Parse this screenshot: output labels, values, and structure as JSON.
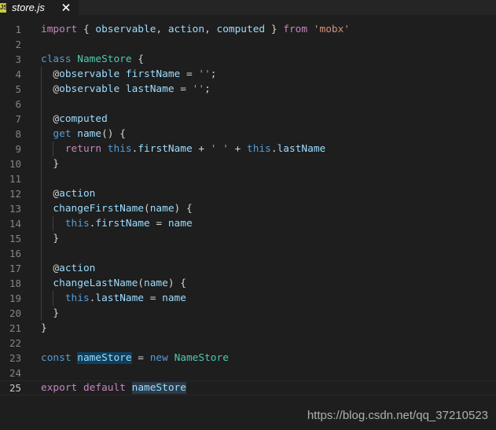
{
  "tab": {
    "icon_text": "JS",
    "filename": "store.js",
    "close_icon": "close-icon"
  },
  "editor": {
    "lines": [
      {
        "n": "1",
        "tokens": [
          [
            "ctl",
            "import"
          ],
          [
            "plain",
            " { "
          ],
          [
            "var",
            "observable"
          ],
          [
            "plain",
            ", "
          ],
          [
            "var",
            "action"
          ],
          [
            "plain",
            ", "
          ],
          [
            "var",
            "computed"
          ],
          [
            "plain",
            " } "
          ],
          [
            "ctl",
            "from"
          ],
          [
            "plain",
            " "
          ],
          [
            "str",
            "'mobx'"
          ]
        ]
      },
      {
        "n": "2",
        "tokens": []
      },
      {
        "n": "3",
        "tokens": [
          [
            "kw",
            "class"
          ],
          [
            "plain",
            " "
          ],
          [
            "cls",
            "NameStore"
          ],
          [
            "plain",
            " {"
          ]
        ]
      },
      {
        "n": "4",
        "tokens": [
          [
            "plain",
            "  "
          ],
          [
            "dec",
            "@"
          ],
          [
            "var",
            "observable"
          ],
          [
            "plain",
            " "
          ],
          [
            "var",
            "firstName"
          ],
          [
            "plain",
            " = "
          ],
          [
            "str",
            "''"
          ],
          [
            "plain",
            ";"
          ]
        ]
      },
      {
        "n": "5",
        "tokens": [
          [
            "plain",
            "  "
          ],
          [
            "dec",
            "@"
          ],
          [
            "var",
            "observable"
          ],
          [
            "plain",
            " "
          ],
          [
            "var",
            "lastName"
          ],
          [
            "plain",
            " = "
          ],
          [
            "str",
            "''"
          ],
          [
            "plain",
            ";"
          ]
        ]
      },
      {
        "n": "6",
        "tokens": []
      },
      {
        "n": "7",
        "tokens": [
          [
            "plain",
            "  "
          ],
          [
            "dec",
            "@"
          ],
          [
            "var",
            "computed"
          ]
        ]
      },
      {
        "n": "8",
        "tokens": [
          [
            "plain",
            "  "
          ],
          [
            "kw",
            "get"
          ],
          [
            "plain",
            " "
          ],
          [
            "var",
            "name"
          ],
          [
            "plain",
            "() {"
          ]
        ]
      },
      {
        "n": "9",
        "tokens": [
          [
            "plain",
            "    "
          ],
          [
            "ctl",
            "return"
          ],
          [
            "plain",
            " "
          ],
          [
            "kw",
            "this"
          ],
          [
            "plain",
            "."
          ],
          [
            "var",
            "firstName"
          ],
          [
            "plain",
            " + "
          ],
          [
            "str",
            "' '"
          ],
          [
            "plain",
            " + "
          ],
          [
            "kw",
            "this"
          ],
          [
            "plain",
            "."
          ],
          [
            "var",
            "lastName"
          ]
        ]
      },
      {
        "n": "10",
        "tokens": [
          [
            "plain",
            "  }"
          ]
        ]
      },
      {
        "n": "11",
        "tokens": []
      },
      {
        "n": "12",
        "tokens": [
          [
            "plain",
            "  "
          ],
          [
            "dec",
            "@"
          ],
          [
            "var",
            "action"
          ]
        ]
      },
      {
        "n": "13",
        "tokens": [
          [
            "plain",
            "  "
          ],
          [
            "var",
            "changeFirstName"
          ],
          [
            "plain",
            "("
          ],
          [
            "var",
            "name"
          ],
          [
            "plain",
            ") {"
          ]
        ]
      },
      {
        "n": "14",
        "tokens": [
          [
            "plain",
            "    "
          ],
          [
            "kw",
            "this"
          ],
          [
            "plain",
            "."
          ],
          [
            "var",
            "firstName"
          ],
          [
            "plain",
            " = "
          ],
          [
            "var",
            "name"
          ]
        ]
      },
      {
        "n": "15",
        "tokens": [
          [
            "plain",
            "  }"
          ]
        ]
      },
      {
        "n": "16",
        "tokens": []
      },
      {
        "n": "17",
        "tokens": [
          [
            "plain",
            "  "
          ],
          [
            "dec",
            "@"
          ],
          [
            "var",
            "action"
          ]
        ]
      },
      {
        "n": "18",
        "tokens": [
          [
            "plain",
            "  "
          ],
          [
            "var",
            "changeLastName"
          ],
          [
            "plain",
            "("
          ],
          [
            "var",
            "name"
          ],
          [
            "plain",
            ") {"
          ]
        ]
      },
      {
        "n": "19",
        "tokens": [
          [
            "plain",
            "    "
          ],
          [
            "kw",
            "this"
          ],
          [
            "plain",
            "."
          ],
          [
            "var",
            "lastName"
          ],
          [
            "plain",
            " = "
          ],
          [
            "var",
            "name"
          ]
        ]
      },
      {
        "n": "20",
        "tokens": [
          [
            "plain",
            "  }"
          ]
        ]
      },
      {
        "n": "21",
        "tokens": [
          [
            "plain",
            "}"
          ]
        ]
      },
      {
        "n": "22",
        "tokens": []
      },
      {
        "n": "23",
        "tokens": [
          [
            "kw",
            "const"
          ],
          [
            "plain",
            " "
          ],
          [
            "var hl",
            "nameStore"
          ],
          [
            "plain",
            " = "
          ],
          [
            "kw",
            "new"
          ],
          [
            "plain",
            " "
          ],
          [
            "cls",
            "NameStore"
          ]
        ]
      },
      {
        "n": "24",
        "tokens": []
      },
      {
        "n": "25",
        "tokens": [
          [
            "ctl",
            "export"
          ],
          [
            "plain",
            " "
          ],
          [
            "ctl",
            "default"
          ],
          [
            "plain",
            " "
          ],
          [
            "var hl2",
            "nameStore"
          ]
        ]
      }
    ],
    "current_line": "25"
  },
  "watermark": "https://blog.csdn.net/qq_37210523"
}
